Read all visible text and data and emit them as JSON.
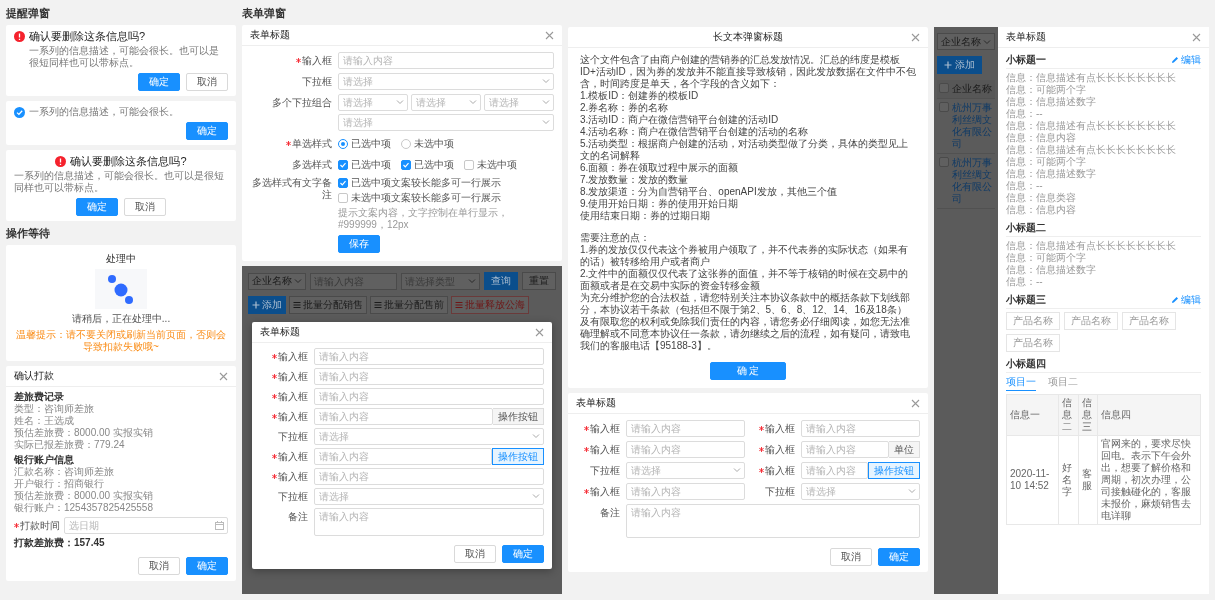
{
  "alert_section": {
    "title": "提醒弹窗",
    "dialogs": [
      {
        "kind": "confirm",
        "title": "确认要删除这条信息吗?",
        "description": "一系列的信息描述，可能会很长。也可以是很短同样也可以带标点。",
        "buttons": [
          {
            "label": "确定",
            "primary": true
          },
          {
            "label": "取消",
            "primary": false
          }
        ]
      },
      {
        "kind": "notice",
        "description": "一系列的信息描述，可能会很长。",
        "buttons": [
          {
            "label": "确定",
            "primary": true
          }
        ]
      },
      {
        "kind": "confirm-centered",
        "title": "确认要删除这条信息吗?",
        "description": "一系列的信息描述，可能会很长。也可以是很短同样也可以带标点。",
        "buttons": [
          {
            "label": "确定",
            "primary": true
          },
          {
            "label": "取消",
            "primary": false
          }
        ]
      }
    ]
  },
  "waiting_section": {
    "title": "操作等待",
    "status": "处理中",
    "message": "请稍后，正在处理中...",
    "warning": "温馨提示：请不要关闭或刷新当前页面，否则会导致扣款失败哦~"
  },
  "payment_dialog": {
    "title": "确认打款",
    "groups": [
      {
        "title": "差旅费记录",
        "lines": [
          "类型：咨询师差旅",
          "姓名：王选成",
          "预估差旅费：8000.00 实报实销",
          "实际已报差旅费：779.24"
        ]
      },
      {
        "title": "银行账户信息",
        "lines": [
          "汇款名称：咨询师差旅",
          "开户银行：招商银行",
          "预估差旅费：8000.00 实报实销",
          "银行账户：1254357825425558"
        ]
      }
    ],
    "field": {
      "label": "打款时间",
      "required": true,
      "placeholder": "选日期"
    },
    "total": "打款差旅费：157.45",
    "buttons": [
      {
        "label": "取消",
        "primary": false
      },
      {
        "label": "确定",
        "primary": true
      }
    ]
  },
  "form_section": {
    "title": "表单弹窗"
  },
  "basic_form": {
    "title": "表单标题",
    "fields": [
      {
        "kind": "input",
        "label": "输入框",
        "required": true,
        "placeholder": "请输入内容"
      },
      {
        "kind": "select",
        "label": "下拉框",
        "required": false,
        "placeholder": "请选择"
      },
      {
        "kind": "select-group",
        "label": "多个下拉组合",
        "required": false,
        "placeholders": [
          "请选择",
          "请选择",
          "请选择",
          "请选择"
        ]
      },
      {
        "kind": "radio",
        "label": "单选样式",
        "required": true,
        "options": [
          {
            "label": "已选中项",
            "selected": true
          },
          {
            "label": "未选中项",
            "selected": false
          }
        ]
      },
      {
        "kind": "checkbox",
        "label": "多选样式",
        "required": false,
        "options": [
          {
            "label": "已选中项",
            "checked": true
          },
          {
            "label": "已选中项",
            "checked": true
          },
          {
            "label": "未选中项",
            "checked": false
          }
        ]
      },
      {
        "kind": "checkbox-list",
        "label": "多选样式有文字备注",
        "required": false,
        "options": [
          {
            "label": "已选中项文案较长能多可一行展示",
            "checked": true
          },
          {
            "label": "未选中项文案较长能多可一行展示",
            "checked": false
          }
        ],
        "note": "提示文案内容，文字控制在单行显示，#999999，12px"
      }
    ],
    "submit": "保存"
  },
  "list_overlay_dialog": {
    "kind": "dialog",
    "filter": {
      "select": "企业名称",
      "input_placeholder": "请输入内容",
      "type_placeholder": "请选择类型",
      "search": "查询",
      "reset": "重置"
    },
    "toolbar": {
      "add": "添加",
      "batch": [
        {
          "label": "批量分配销售",
          "danger": false
        },
        {
          "label": "批量分配售前",
          "danger": false
        },
        {
          "label": "批量释放公海",
          "danger": true
        }
      ]
    },
    "dialog": {
      "title": "表单标题",
      "fields": [
        {
          "kind": "input",
          "label": "输入框",
          "required": true,
          "placeholder": "请输入内容"
        },
        {
          "kind": "input",
          "label": "输入框",
          "required": true,
          "placeholder": "请输入内容"
        },
        {
          "kind": "input",
          "label": "输入框",
          "required": true,
          "placeholder": "请输入内容"
        },
        {
          "kind": "input",
          "label": "输入框",
          "required": true,
          "placeholder": "请输入内容",
          "addon": {
            "kind": "text",
            "label": "操作按钮"
          }
        },
        {
          "kind": "select",
          "label": "下拉框",
          "required": false,
          "placeholder": "请选择"
        },
        {
          "kind": "input",
          "label": "输入框",
          "required": true,
          "placeholder": "请输入内容",
          "addon": {
            "kind": "button",
            "label": "操作按钮"
          }
        },
        {
          "kind": "input",
          "label": "输入框",
          "required": true,
          "placeholder": "请输入内容"
        },
        {
          "kind": "select",
          "label": "下拉框",
          "required": false,
          "placeholder": "请选择"
        }
      ],
      "remark": {
        "label": "备注",
        "placeholder": "请输入内容"
      },
      "buttons": [
        {
          "label": "取消",
          "primary": false
        },
        {
          "label": "确定",
          "primary": true
        }
      ]
    }
  },
  "long_text_dialog": {
    "title": "长文本弹窗标题",
    "blocks": [
      {
        "lines": [
          "这个文件包含了由商户创建的营销券的汇总发放情况。汇总的纬度是模板ID+活动ID，因为券的发放并不能直接导致核销，因此发放数据在文件中不包含，时间跨度是单天，各个字段的含义如下：",
          "1.模板ID：创建券的模板ID",
          "2.券名称：券的名称",
          "3.活动ID：商户在微信营销平台创建的活动ID",
          "4.活动名称：商户在微信营销平台创建的活动的名称",
          "5.活动类型：根据商户创建的活动，对活动类型做了分类，具体的类型见上文的名词解释",
          "6.面额：券在领取过程中展示的面额",
          "7.发放数量：发放的数量",
          "8.发放渠道：分为自营销平台、openAPI发放，其他三个值",
          "9.使用开始日期：券的使用开始日期",
          "使用结束日期：券的过期日期"
        ]
      },
      {
        "lines": [
          "需要注意的点：",
          "1.券的发放仅仅代表这个券被用户领取了，并不代表券的实际状态（如果有的话）被转移给用户或者商户",
          "2.文件中的面额仅仅代表了这张券的面值，并不等于核销的时候在交易中的面额或者是在交易中实际的资金转移金额",
          "为充分维护您的合法权益，请您特别关注本协议条款中的概括条款下划线部分，本协议若干条款（包括但不限于第2、5、6、8、12、14、16及18条）及有限取您的权利或免除我们责任的内容，请您务必仔细阅读，如您无法准确理解或不同意本协议任一条款，请勿继续之后的流程，如有疑问，请致电我们的客服电话【95188-3】。"
        ]
      }
    ],
    "button": "确 定"
  },
  "grid_form": {
    "title": "表单标题",
    "fields": [
      {
        "kind": "input",
        "label": "输入框",
        "required": true,
        "placeholder": "请输入内容"
      },
      {
        "kind": "input",
        "label": "输入框",
        "required": true,
        "placeholder": "请输入内容"
      },
      {
        "kind": "input",
        "label": "输入框",
        "required": true,
        "placeholder": "请输入内容"
      },
      {
        "kind": "input",
        "label": "输入框",
        "required": true,
        "placeholder": "请输入内容",
        "addon": {
          "kind": "text",
          "label": "单位"
        }
      },
      {
        "kind": "select",
        "label": "下拉框",
        "required": false,
        "placeholder": "请选择"
      },
      {
        "kind": "input",
        "label": "输入框",
        "required": true,
        "placeholder": "请输入内容",
        "addon": {
          "kind": "button",
          "label": "操作按钮"
        }
      },
      {
        "kind": "input",
        "label": "输入框",
        "required": true,
        "placeholder": "请输入内容"
      },
      {
        "kind": "select",
        "label": "下拉框",
        "required": false,
        "placeholder": "请选择"
      }
    ],
    "remark": {
      "label": "备注",
      "placeholder": "请输入内容"
    },
    "buttons": [
      {
        "label": "取消",
        "primary": false
      },
      {
        "label": "确定",
        "primary": true
      }
    ]
  },
  "list_overlay_drawer": {
    "kind": "drawer",
    "select": "企业名称",
    "add": "添加",
    "table": {
      "header": {
        "checked": false,
        "label": "企业名称"
      },
      "rows": [
        {
          "checked": false,
          "company": "杭州万事利丝绸文化有限公司"
        },
        {
          "checked": false,
          "company": "杭州万事利丝绸文化有限公司"
        }
      ]
    },
    "drawer": {
      "title": "表单标题",
      "sections": [
        {
          "kind": "info",
          "title": "小标题一",
          "edit": "编辑",
          "items": [
            "信息：信息描述有点长长长长长长长长",
            "信息：可能两个字",
            "信息：信息描述数字",
            "信息：--",
            "信息：信息描述有点长长长长长长长长",
            "信息：信息内容",
            "信息：信息描述有点长长长长长长长长",
            "信息：可能两个字",
            "信息：信息描述数字",
            "信息：--",
            "信息：信息类容",
            "信息：信息内容"
          ]
        },
        {
          "kind": "info",
          "title": "小标题二",
          "items": [
            "信息：信息描述有点长长长长长长长长",
            "信息：可能两个字",
            "信息：信息描述数字",
            "信息：--"
          ]
        },
        {
          "kind": "tags",
          "title": "小标题三",
          "edit": "编辑",
          "tags": [
            "产品名称",
            "产品名称",
            "产品名称",
            "产品名称"
          ]
        },
        {
          "kind": "tabs-table",
          "title": "小标题四",
          "tabs": [
            {
              "label": "项目一",
              "selected": true
            },
            {
              "label": "项目二",
              "selected": false
            }
          ],
          "columns": [
            "信息一",
            "信息二",
            "信息三",
            "信息四"
          ],
          "rows": [
            [
              "2020-11-10 14:52",
              "好名字",
              "客服",
              "官网来的，要求尽快回电。表示下午会外出，想要了解价格和周期，初次办理，公司接触碰化的，客服未报价，麻烦销售去电详聊"
            ]
          ]
        }
      ]
    }
  }
}
